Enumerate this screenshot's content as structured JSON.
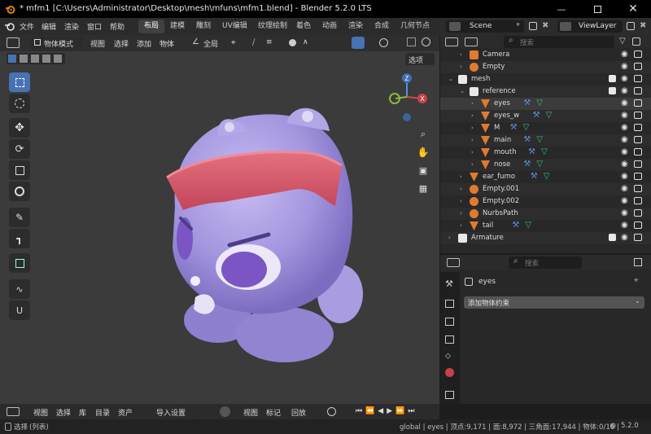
{
  "window": {
    "title": "* mfm1 [C:\\Users\\Administrator\\Desktop\\mesh\\mfuns\\mfm1.blend] - Blender 5.2.0 LTS"
  },
  "menubar": {
    "items": [
      "文件",
      "编辑",
      "渲染",
      "窗口",
      "帮助"
    ],
    "workspaces": [
      "布局",
      "建模",
      "雕刻",
      "UV编辑",
      "纹理绘制",
      "着色",
      "动画",
      "渲染",
      "合成",
      "几何节点"
    ],
    "active_workspace": "布局",
    "scene": "Scene",
    "view_layer": "ViewLayer"
  },
  "viewport_header": {
    "mode": "物体模式",
    "menus": [
      "视图",
      "选择",
      "添加",
      "物体"
    ],
    "transform_orientation": "全局",
    "options_label": "选项"
  },
  "outliner": {
    "search_placeholder": "搜索",
    "rows": [
      {
        "label": "Camera",
        "indent": 1,
        "icon": "camera"
      },
      {
        "label": "Empty",
        "indent": 1,
        "icon": "empty"
      },
      {
        "label": "mesh",
        "indent": 0,
        "icon": "collection"
      },
      {
        "label": "reference",
        "indent": 1,
        "icon": "collection"
      },
      {
        "label": "eyes",
        "indent": 2,
        "icon": "mesh"
      },
      {
        "label": "eyes_w",
        "indent": 2,
        "icon": "mesh"
      },
      {
        "label": "M",
        "indent": 2,
        "icon": "mesh"
      },
      {
        "label": "main",
        "indent": 2,
        "icon": "mesh"
      },
      {
        "label": "mouth",
        "indent": 2,
        "icon": "mesh"
      },
      {
        "label": "nose",
        "indent": 2,
        "icon": "mesh"
      },
      {
        "label": "ear_fumo",
        "indent": 1,
        "icon": "mesh"
      },
      {
        "label": "Empty.001",
        "indent": 1,
        "icon": "empty"
      },
      {
        "label": "Empty.002",
        "indent": 1,
        "icon": "empty"
      },
      {
        "label": "NurbsPath",
        "indent": 1,
        "icon": "curve"
      },
      {
        "label": "tail",
        "indent": 1,
        "icon": "mesh"
      },
      {
        "label": "Armature",
        "indent": 0,
        "icon": "collection"
      }
    ]
  },
  "properties": {
    "search_placeholder": "搜索",
    "object_name": "eyes",
    "add_constraint": "添加物体约束"
  },
  "timeline": {
    "menus": [
      "视图",
      "选择",
      "库",
      "目录",
      "资产"
    ],
    "import_settings": "导入设置",
    "view_menus": [
      "视图",
      "标记"
    ],
    "playback": "回放"
  },
  "statusbar": {
    "left_hint": "选择",
    "left_sub": "(列表)",
    "stats": "global | eyes | 顶点:9,171 | 面:8,972 | 三角面:17,944 | 物体:0/16 |",
    "version": "5.2.0"
  },
  "colors": {
    "accent": "#4772b3",
    "character": "#a79ae0",
    "headband": "#d9566b",
    "mesh_icon": "#e07b2e",
    "modifier_icon": "#5a8fd8",
    "data_icon": "#33c08a"
  }
}
